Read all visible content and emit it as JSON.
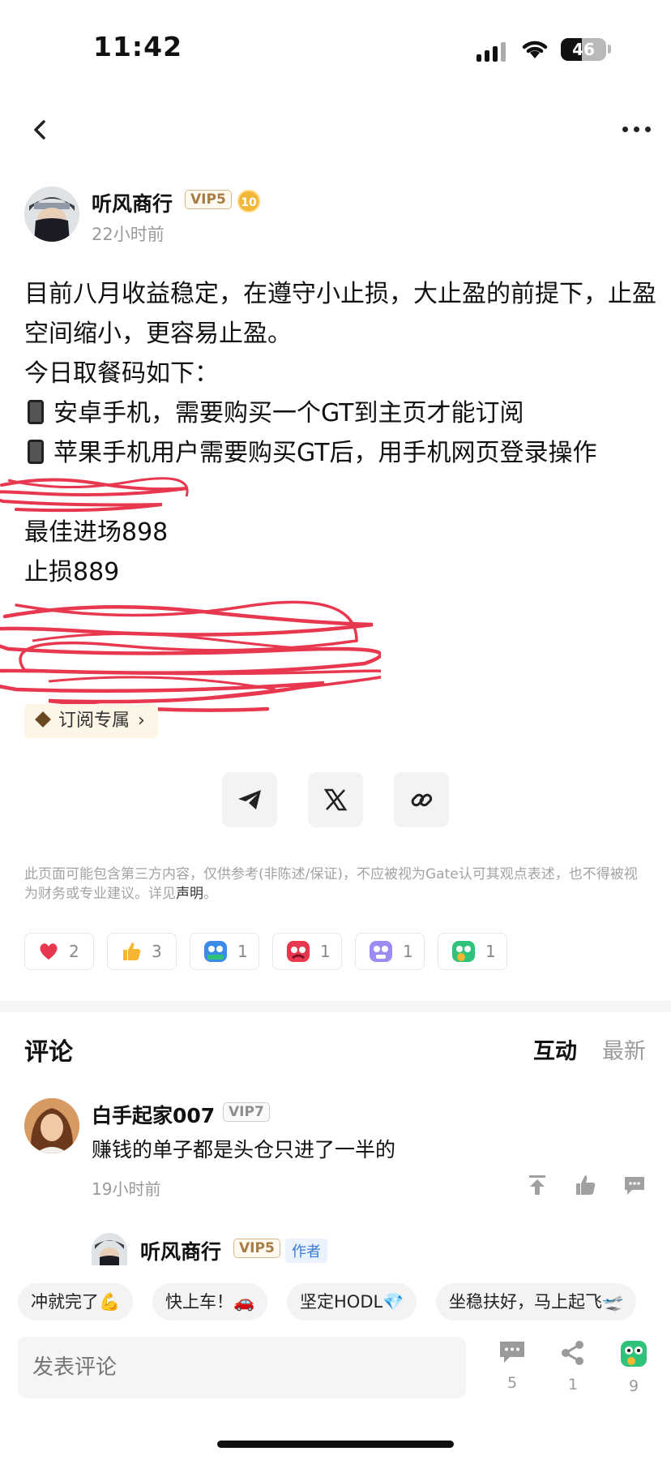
{
  "status_bar": {
    "time": "11:42",
    "battery_level": "46"
  },
  "post": {
    "author": {
      "name": "听风商行",
      "vip": "VIP5",
      "level": "10",
      "time": "22小时前"
    },
    "body": {
      "line1": "目前八月收益稳定，在遵守小止损，大止盈的前提下，止盈空间缩小，更容易止盈。",
      "line2": "今日取餐码如下：",
      "line3": "安卓手机，需要购买一个GT到主页才能订阅",
      "line4": "苹果手机用户需要购买GT后，用手机网页登录操作",
      "line5": "最佳进场898",
      "line6": "止损889"
    },
    "subscribe_label": "订阅专属",
    "disclaimer": "此页面可能包含第三方内容，仅供参考(非陈述/保证)，不应被视为Gate认可其观点表述，也不得被视为财务或专业建议。详见",
    "disclaimer_link": "声明",
    "reactions": [
      {
        "icon": "heart-icon",
        "count": "2"
      },
      {
        "icon": "thumbs-up-icon",
        "count": "3"
      },
      {
        "icon": "hodl-icon",
        "count": "1"
      },
      {
        "icon": "angry-face-icon",
        "count": "1"
      },
      {
        "icon": "crying-face-icon",
        "count": "1"
      },
      {
        "icon": "green-monster-icon",
        "count": "1"
      }
    ]
  },
  "comments": {
    "title": "评论",
    "tab_interact": "互动",
    "tab_latest": "最新",
    "items": [
      {
        "name": "白手起家007",
        "vip": "VIP7",
        "text": "赚钱的单子都是头仓只进了一半的",
        "time": "19小时前"
      }
    ],
    "reply": {
      "name": "听风商行",
      "vip": "VIP5",
      "tag": "作者"
    }
  },
  "quick_replies": [
    "冲就完了💪",
    "快上车！🚗",
    "坚定HODL💎",
    "坐稳扶好，马上起飞🛫"
  ],
  "bottom_bar": {
    "input_placeholder": "发表评论",
    "comment_count": "5",
    "share_count": "1",
    "reaction_count": "9"
  },
  "colors": {
    "accent_red": "#e8384f",
    "vip_gold": "#a57c43",
    "author_tag_blue": "#3a7bd5"
  }
}
